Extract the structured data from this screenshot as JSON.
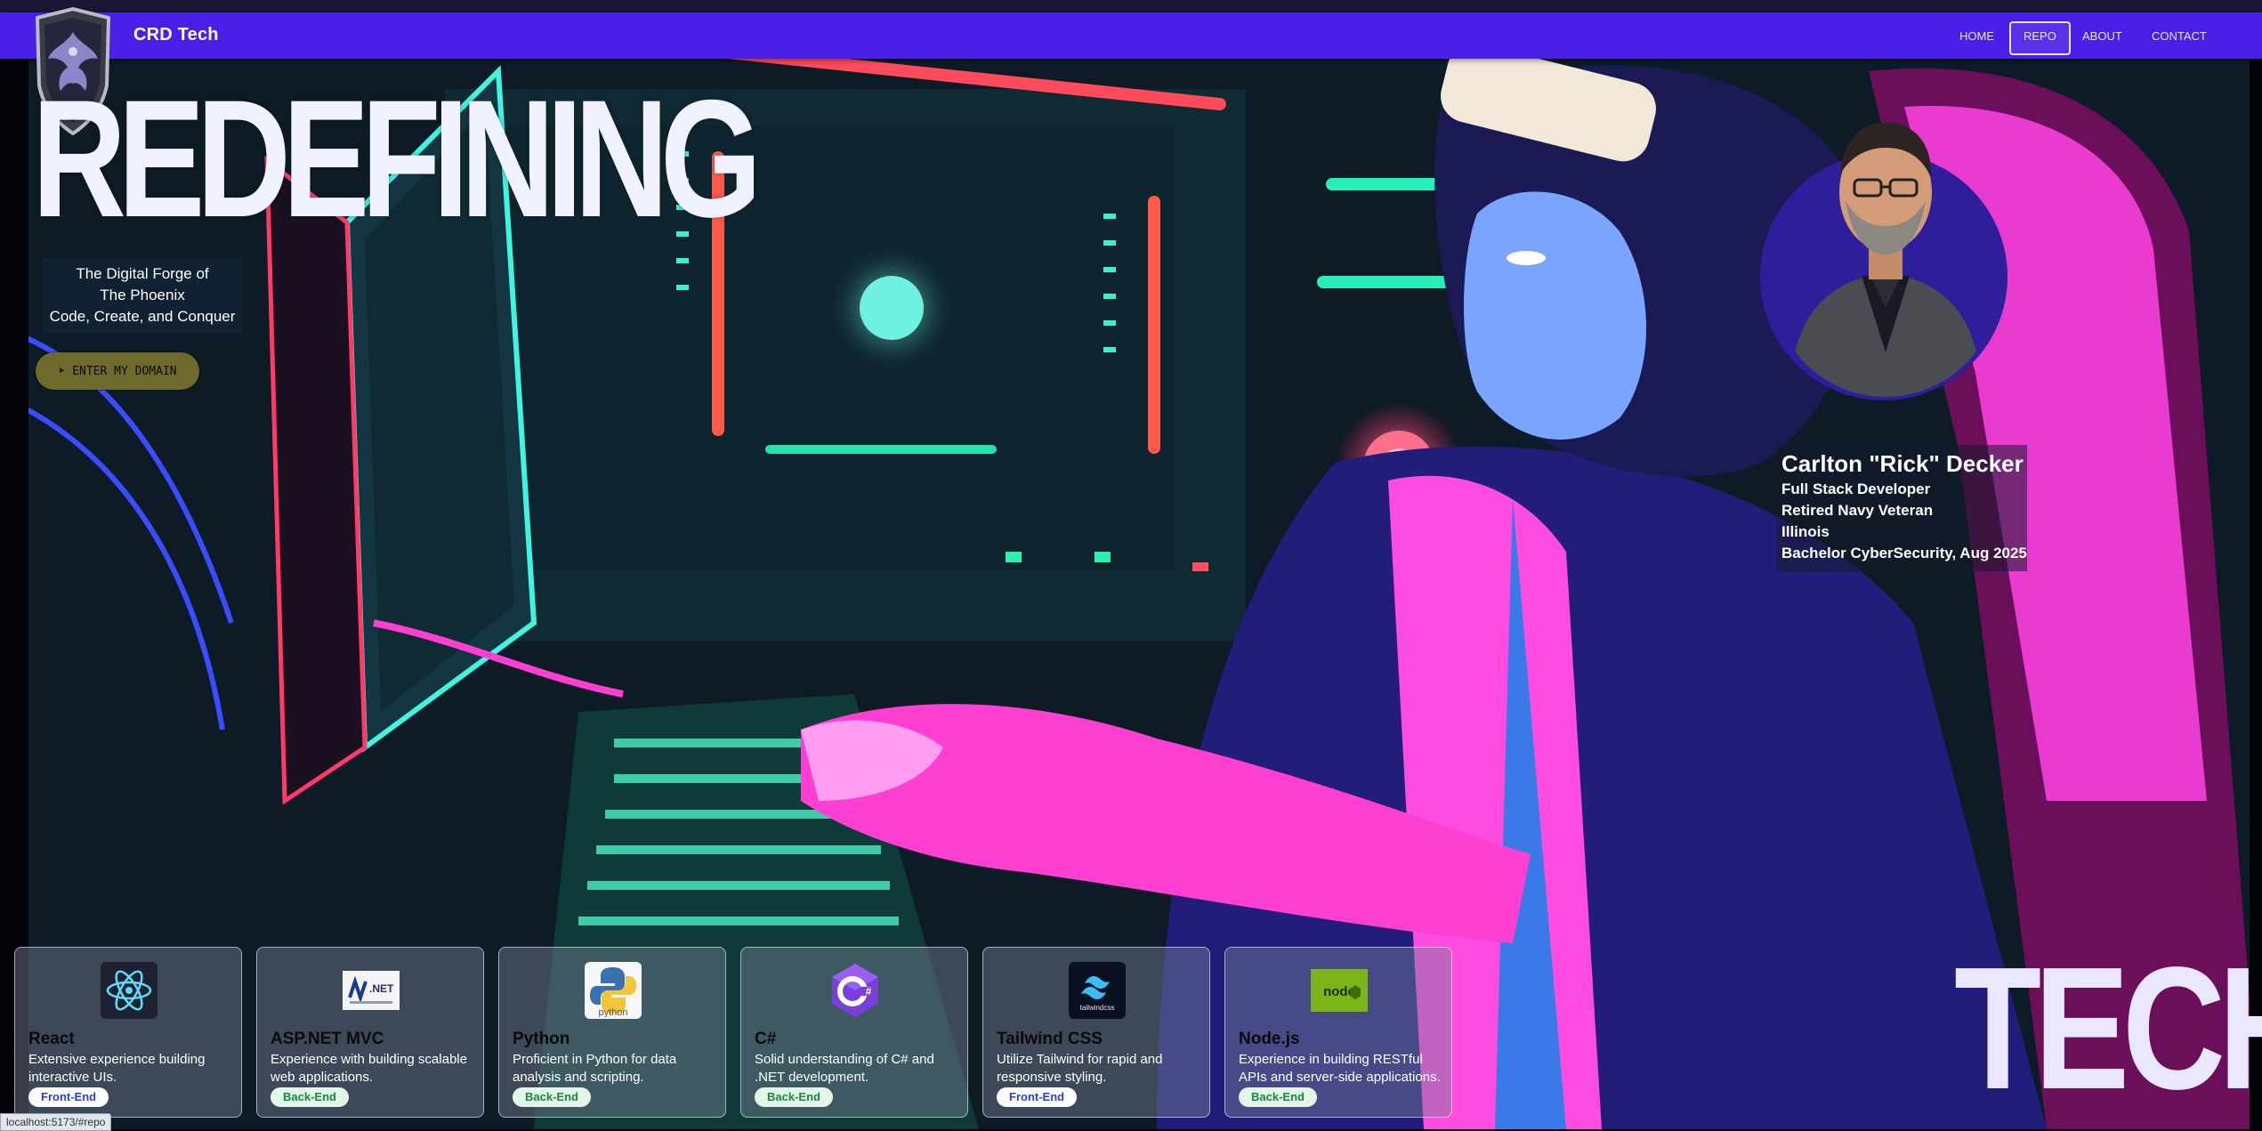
{
  "nav": {
    "brand": "CRD Tech",
    "links": [
      {
        "label": "HOME",
        "active": false
      },
      {
        "label": "REPO",
        "active": true
      },
      {
        "label": "ABOUT",
        "active": false
      },
      {
        "label": "CONTACT",
        "active": false
      }
    ]
  },
  "hero": {
    "headline": "REDEFINING",
    "tagline": [
      "The Digital Forge of",
      "The Phoenix",
      "Code, Create, and Conquer"
    ],
    "cta_label": "ENTER MY DOMAIN",
    "cta_icon": "send-arrow-icon",
    "footer_word": "TECH"
  },
  "profile": {
    "name": "Carlton \"Rick\" Decker",
    "lines": [
      "Full Stack Developer",
      "Retired Navy Veteran",
      "Illinois",
      "Bachelor CyberSecurity, Aug 2025"
    ]
  },
  "skills": [
    {
      "title": "React",
      "description": "Extensive experience building interactive UIs.",
      "badge": "Front-End",
      "logo": "react-logo"
    },
    {
      "title": "ASP.NET MVC",
      "description": "Experience with building scalable web applications.",
      "badge": "Back-End",
      "logo": "dotnet-logo"
    },
    {
      "title": "Python",
      "description": "Proficient in Python for data analysis and scripting.",
      "badge": "Back-End",
      "logo": "python-logo"
    },
    {
      "title": "C#",
      "description": "Solid understanding of C# and .NET development.",
      "badge": "Back-End",
      "logo": "csharp-logo"
    },
    {
      "title": "Tailwind CSS",
      "description": "Utilize Tailwind for rapid and responsive styling.",
      "badge": "Front-End",
      "logo": "tailwind-logo"
    },
    {
      "title": "Node.js",
      "description": "Experience in building RESTful APIs and server-side applications.",
      "badge": "Back-End",
      "logo": "nodejs-logo"
    }
  ],
  "logo_texts": {
    "dotnet": ".NET",
    "python": "python",
    "tailwind": "tailwindcss",
    "node": "node"
  },
  "status_url": "localhost:5173/#repo",
  "colors": {
    "nav_bg": "#4a20e8",
    "cta_bg": "#6f6a2c",
    "front_badge": "#2a3fd1",
    "back_badge": "#138a3c",
    "avatar_ring": "#2d1f9c"
  }
}
